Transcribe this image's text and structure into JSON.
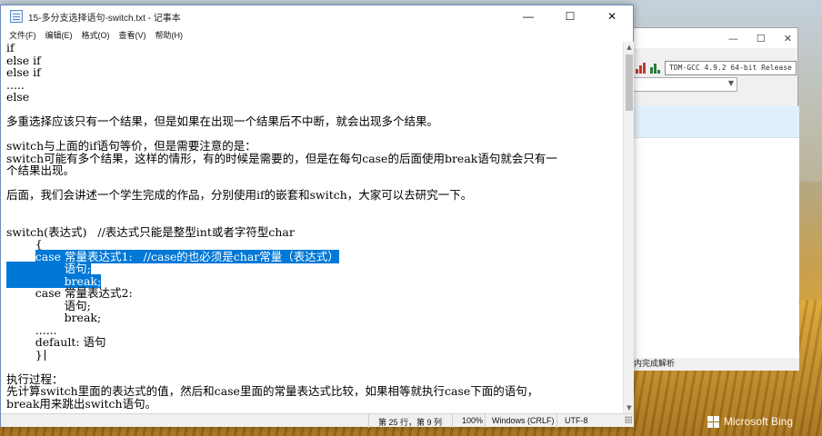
{
  "notepad": {
    "title": "15-多分支选择语句-switch.txt - 记事本",
    "controls": {
      "minimize": "—",
      "maximize": "☐",
      "close": "✕"
    },
    "menu": [
      "文件(F)",
      "编辑(E)",
      "格式(O)",
      "查看(V)",
      "帮助(H)"
    ],
    "lines": [
      {
        "text": "if"
      },
      {
        "text": "else if"
      },
      {
        "text": "else if"
      },
      {
        "text": "....."
      },
      {
        "text": "else"
      },
      {
        "text": ""
      },
      {
        "text": "多重选择应该只有一个结果，但是如果在出现一个结果后不中断，就会出现多个结果。"
      },
      {
        "text": ""
      },
      {
        "text": "switch与上面的if语句等价，但是需要注意的是："
      },
      {
        "text": "switch可能有多个结果，这样的情形，有的时候是需要的，但是在每句case的后面使用break语句就会只有一"
      },
      {
        "text": "个结果出现。"
      },
      {
        "text": ""
      },
      {
        "text": "后面，我们会讲述一个学生完成的作品，分别使用if的嵌套和switch，大家可以去研究一下。"
      },
      {
        "text": ""
      },
      {
        "text": ""
      },
      {
        "text": "switch(表达式)   //表达式只能是整型int或者字符型char"
      },
      {
        "text": "        {"
      },
      {
        "text": "        case 常量表达式1:   //case的也必须是char常量（表达式）",
        "sel_from": 8
      },
      {
        "text": "                语句;",
        "sel_from": 0
      },
      {
        "text": "                break;",
        "sel_from": 0
      },
      {
        "text": "        case 常量表达式2:"
      },
      {
        "text": "                语句;"
      },
      {
        "text": "                break;"
      },
      {
        "text": "        ......"
      },
      {
        "text": "        default: 语句"
      },
      {
        "text": "        }",
        "caret": true
      },
      {
        "text": ""
      },
      {
        "text": "执行过程："
      },
      {
        "text": "先计算switch里面的表达式的值，然后和case里面的常量表达式比较，如果相等就执行case下面的语句，"
      },
      {
        "text": "break用来跳出switch语句。"
      }
    ],
    "status": {
      "position": "第 25 行，第 9 列",
      "zoom": "100%",
      "line_ending": "Windows (CRLF)",
      "encoding": "UTF-8"
    }
  },
  "devcpp": {
    "controls": {
      "minimize": "—",
      "maximize": "☐",
      "close": "✕"
    },
    "compiler": "TDM-GCC 4.9.2 64-bit Release",
    "status_text": "内完成解析"
  },
  "desktop": {
    "bing_label": "Microsoft Bing"
  },
  "colors": {
    "selection": "#0078d7",
    "window_border": "#6b8fba"
  }
}
